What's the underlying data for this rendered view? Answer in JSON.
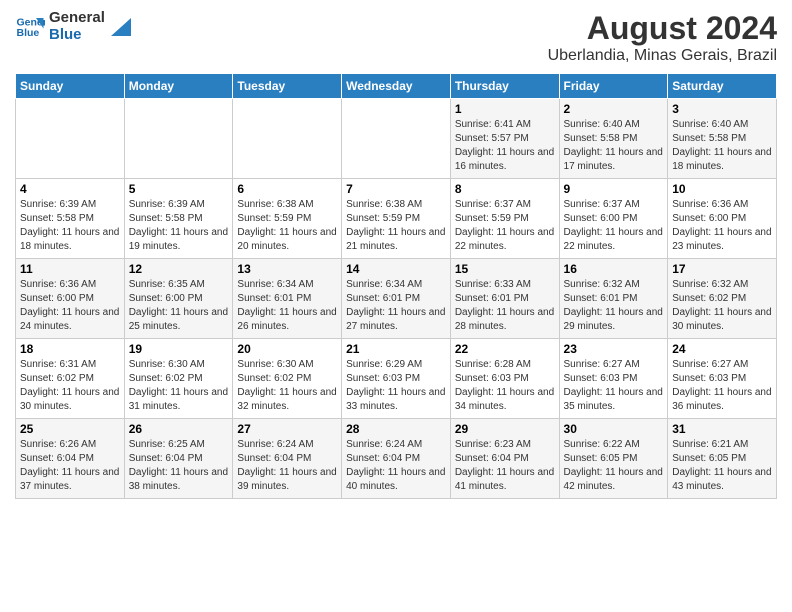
{
  "logo": {
    "line1": "General",
    "line2": "Blue"
  },
  "title": "August 2024",
  "subtitle": "Uberlandia, Minas Gerais, Brazil",
  "days_of_week": [
    "Sunday",
    "Monday",
    "Tuesday",
    "Wednesday",
    "Thursday",
    "Friday",
    "Saturday"
  ],
  "weeks": [
    [
      {
        "day": "",
        "info": ""
      },
      {
        "day": "",
        "info": ""
      },
      {
        "day": "",
        "info": ""
      },
      {
        "day": "",
        "info": ""
      },
      {
        "day": "1",
        "info": "Sunrise: 6:41 AM\nSunset: 5:57 PM\nDaylight: 11 hours and 16 minutes."
      },
      {
        "day": "2",
        "info": "Sunrise: 6:40 AM\nSunset: 5:58 PM\nDaylight: 11 hours and 17 minutes."
      },
      {
        "day": "3",
        "info": "Sunrise: 6:40 AM\nSunset: 5:58 PM\nDaylight: 11 hours and 18 minutes."
      }
    ],
    [
      {
        "day": "4",
        "info": "Sunrise: 6:39 AM\nSunset: 5:58 PM\nDaylight: 11 hours and 18 minutes."
      },
      {
        "day": "5",
        "info": "Sunrise: 6:39 AM\nSunset: 5:58 PM\nDaylight: 11 hours and 19 minutes."
      },
      {
        "day": "6",
        "info": "Sunrise: 6:38 AM\nSunset: 5:59 PM\nDaylight: 11 hours and 20 minutes."
      },
      {
        "day": "7",
        "info": "Sunrise: 6:38 AM\nSunset: 5:59 PM\nDaylight: 11 hours and 21 minutes."
      },
      {
        "day": "8",
        "info": "Sunrise: 6:37 AM\nSunset: 5:59 PM\nDaylight: 11 hours and 22 minutes."
      },
      {
        "day": "9",
        "info": "Sunrise: 6:37 AM\nSunset: 6:00 PM\nDaylight: 11 hours and 22 minutes."
      },
      {
        "day": "10",
        "info": "Sunrise: 6:36 AM\nSunset: 6:00 PM\nDaylight: 11 hours and 23 minutes."
      }
    ],
    [
      {
        "day": "11",
        "info": "Sunrise: 6:36 AM\nSunset: 6:00 PM\nDaylight: 11 hours and 24 minutes."
      },
      {
        "day": "12",
        "info": "Sunrise: 6:35 AM\nSunset: 6:00 PM\nDaylight: 11 hours and 25 minutes."
      },
      {
        "day": "13",
        "info": "Sunrise: 6:34 AM\nSunset: 6:01 PM\nDaylight: 11 hours and 26 minutes."
      },
      {
        "day": "14",
        "info": "Sunrise: 6:34 AM\nSunset: 6:01 PM\nDaylight: 11 hours and 27 minutes."
      },
      {
        "day": "15",
        "info": "Sunrise: 6:33 AM\nSunset: 6:01 PM\nDaylight: 11 hours and 28 minutes."
      },
      {
        "day": "16",
        "info": "Sunrise: 6:32 AM\nSunset: 6:01 PM\nDaylight: 11 hours and 29 minutes."
      },
      {
        "day": "17",
        "info": "Sunrise: 6:32 AM\nSunset: 6:02 PM\nDaylight: 11 hours and 30 minutes."
      }
    ],
    [
      {
        "day": "18",
        "info": "Sunrise: 6:31 AM\nSunset: 6:02 PM\nDaylight: 11 hours and 30 minutes."
      },
      {
        "day": "19",
        "info": "Sunrise: 6:30 AM\nSunset: 6:02 PM\nDaylight: 11 hours and 31 minutes."
      },
      {
        "day": "20",
        "info": "Sunrise: 6:30 AM\nSunset: 6:02 PM\nDaylight: 11 hours and 32 minutes."
      },
      {
        "day": "21",
        "info": "Sunrise: 6:29 AM\nSunset: 6:03 PM\nDaylight: 11 hours and 33 minutes."
      },
      {
        "day": "22",
        "info": "Sunrise: 6:28 AM\nSunset: 6:03 PM\nDaylight: 11 hours and 34 minutes."
      },
      {
        "day": "23",
        "info": "Sunrise: 6:27 AM\nSunset: 6:03 PM\nDaylight: 11 hours and 35 minutes."
      },
      {
        "day": "24",
        "info": "Sunrise: 6:27 AM\nSunset: 6:03 PM\nDaylight: 11 hours and 36 minutes."
      }
    ],
    [
      {
        "day": "25",
        "info": "Sunrise: 6:26 AM\nSunset: 6:04 PM\nDaylight: 11 hours and 37 minutes."
      },
      {
        "day": "26",
        "info": "Sunrise: 6:25 AM\nSunset: 6:04 PM\nDaylight: 11 hours and 38 minutes."
      },
      {
        "day": "27",
        "info": "Sunrise: 6:24 AM\nSunset: 6:04 PM\nDaylight: 11 hours and 39 minutes."
      },
      {
        "day": "28",
        "info": "Sunrise: 6:24 AM\nSunset: 6:04 PM\nDaylight: 11 hours and 40 minutes."
      },
      {
        "day": "29",
        "info": "Sunrise: 6:23 AM\nSunset: 6:04 PM\nDaylight: 11 hours and 41 minutes."
      },
      {
        "day": "30",
        "info": "Sunrise: 6:22 AM\nSunset: 6:05 PM\nDaylight: 11 hours and 42 minutes."
      },
      {
        "day": "31",
        "info": "Sunrise: 6:21 AM\nSunset: 6:05 PM\nDaylight: 11 hours and 43 minutes."
      }
    ]
  ]
}
